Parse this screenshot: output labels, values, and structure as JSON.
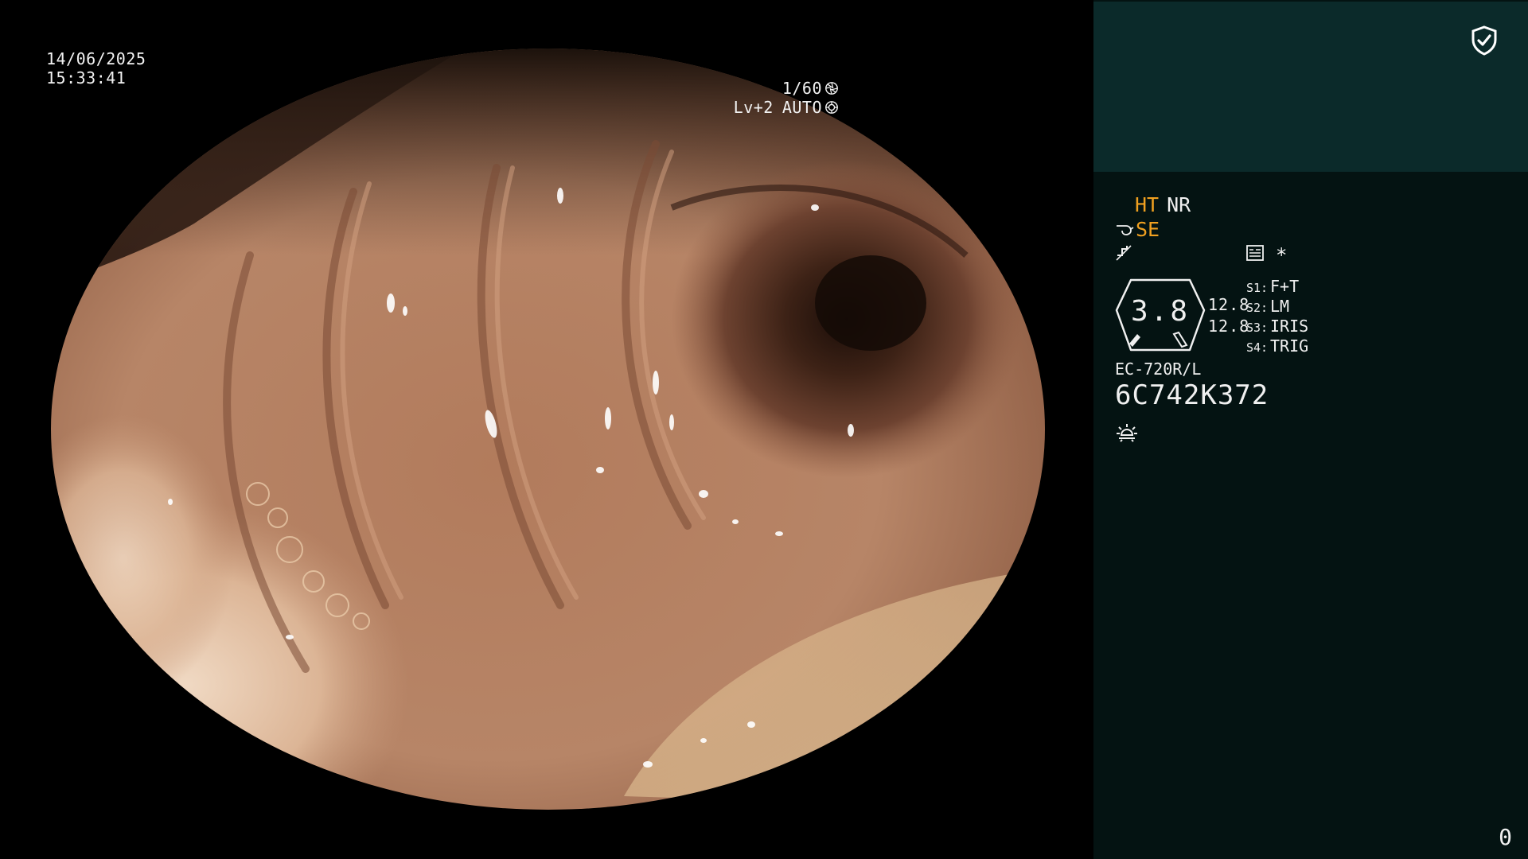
{
  "osd": {
    "date": "14/06/2025",
    "time": "15:33:41",
    "shutter": "1/60",
    "shutter_icon": "aperture-icon",
    "level": "Lv+2",
    "mode": "AUTO",
    "mode_icon": "iris-icon"
  },
  "panel": {
    "shield_icon": "shield-check-icon",
    "ht": "HT",
    "nr": "NR",
    "se": "SE",
    "se_icon": "whistle-icon",
    "pulse_icon": "pulse-icon",
    "memo_icon": "memo-icon",
    "star": "*",
    "gauge_value": "3.8",
    "value_a": "12.8",
    "value_b": "12.8",
    "switches": [
      {
        "key": "S1:",
        "value": "F+T"
      },
      {
        "key": "S2:",
        "value": "LM"
      },
      {
        "key": "S3:",
        "value": "IRIS"
      },
      {
        "key": "S4:",
        "value": "TRIG"
      }
    ],
    "model": "EC-720R/L",
    "serial": "6C742K372",
    "light_icon": "sun-icon",
    "counter": "0"
  },
  "colors": {
    "panel_bg": "#041312",
    "panel_header_bg": "#0b2a2a",
    "accent_orange": "#f0a020",
    "text": "#f0f0f0"
  }
}
